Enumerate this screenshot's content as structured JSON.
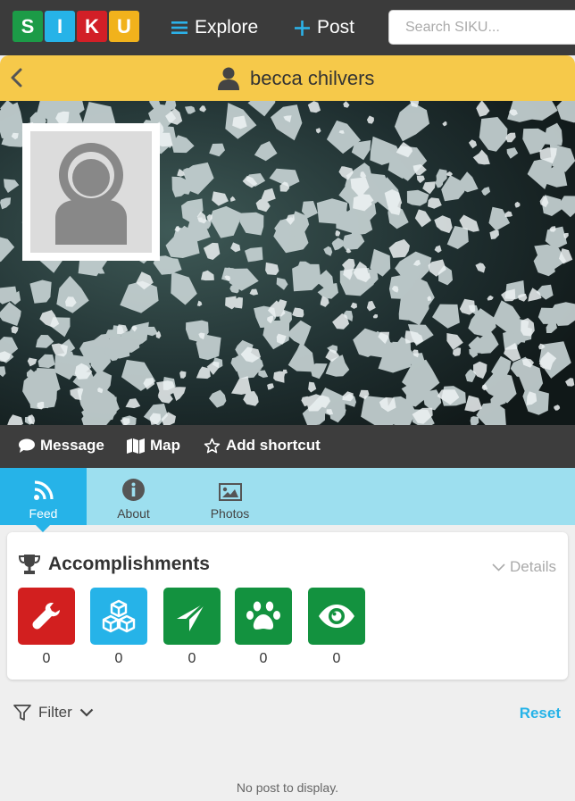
{
  "nav": {
    "logo_letters": [
      "S",
      "I",
      "K",
      "U"
    ],
    "logo_colors": [
      "#1c9b47",
      "#26b3e8",
      "#d21f27",
      "#f1b21c"
    ],
    "explore_label": "Explore",
    "post_label": "Post",
    "search_placeholder": "Search SIKU..."
  },
  "profile": {
    "name": "becca chilvers"
  },
  "actions": {
    "message": "Message",
    "map": "Map",
    "shortcut": "Add shortcut"
  },
  "tabs": [
    {
      "label": "Feed",
      "icon": "rss-icon",
      "active": true
    },
    {
      "label": "About",
      "icon": "info-icon",
      "active": false
    },
    {
      "label": "Photos",
      "icon": "image-icon",
      "active": false
    }
  ],
  "accomplishments": {
    "title": "Accomplishments",
    "details_label": "Details",
    "badges": [
      {
        "icon": "wrench-icon",
        "color": "#d21f1f",
        "count": "0"
      },
      {
        "icon": "cubes-icon",
        "color": "#26b3e8",
        "count": "0"
      },
      {
        "icon": "location-arrow-icon",
        "color": "#13923f",
        "count": "0"
      },
      {
        "icon": "paw-icon",
        "color": "#13923f",
        "count": "0"
      },
      {
        "icon": "eye-icon",
        "color": "#13923f",
        "count": "0"
      }
    ]
  },
  "feed": {
    "filter_label": "Filter",
    "reset_label": "Reset",
    "empty_message": "No post to display."
  }
}
